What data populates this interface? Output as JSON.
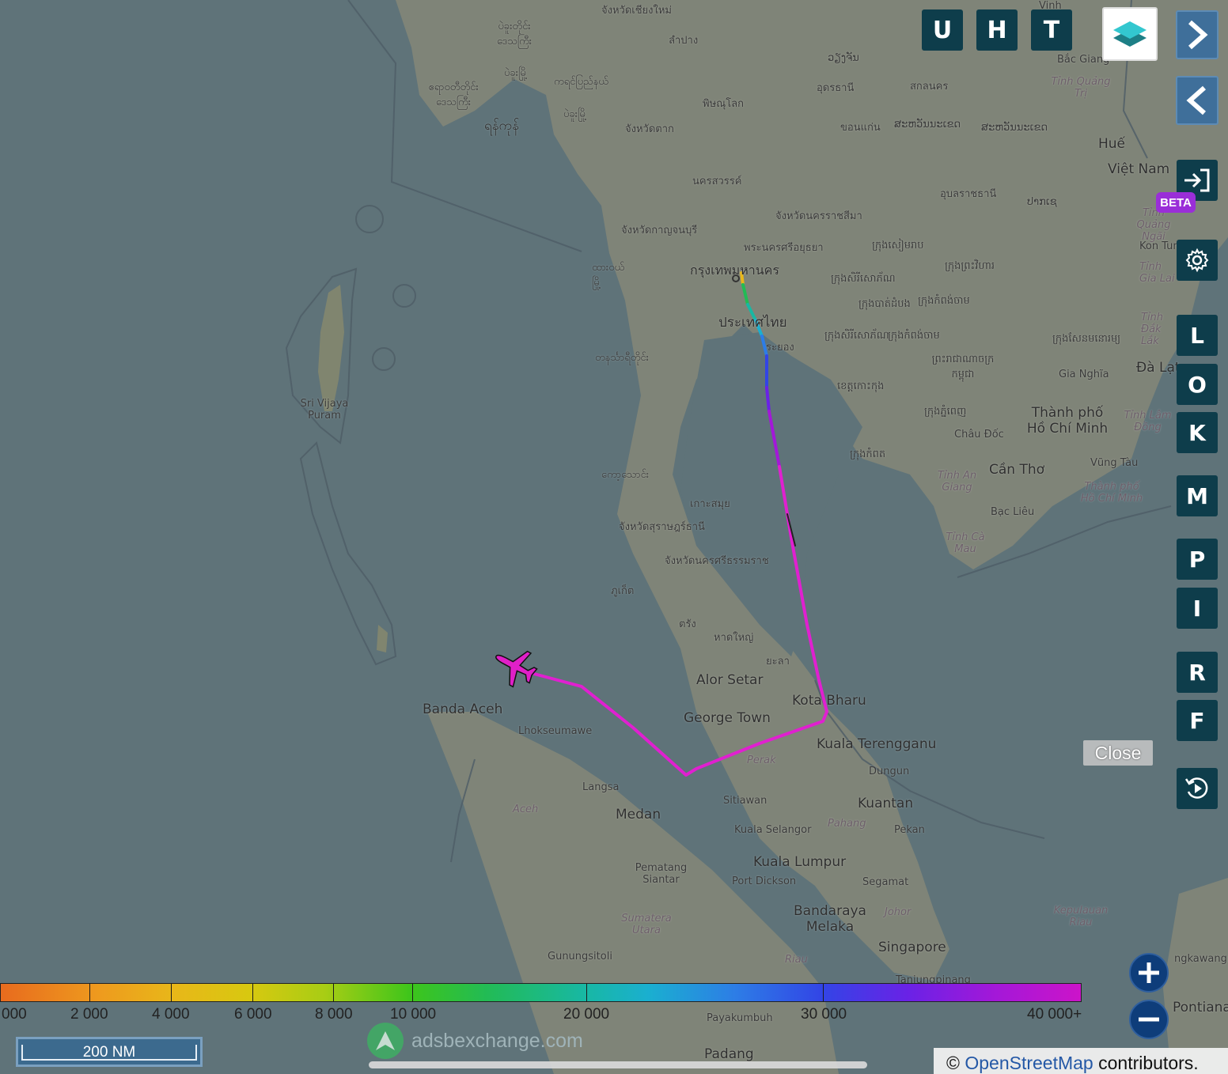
{
  "map": {
    "places": {
      "chiang_mai": "จังหวัดเชียงใหม่",
      "lampang": "ลำปาง",
      "myanmar_region": "ပဲခူးတိုင်း ဒေသကြီး",
      "bago": "ပဲခူးမြို့",
      "ayeyarwady": "ဧရာဝတီတိုင်း ဒေသကြီး",
      "karen": "ကရင်ပြည်နယ်",
      "yangon": "ရန်ကုန်",
      "phitsanulok": "พิษณุโลก",
      "tak": "จังหวัดตาก",
      "kanchanaburi": "จังหวัดกาญจนบุรี",
      "nakhon_sawan": "นครสวรรค์",
      "ayutthaya": "พระนครศรีอยุธยา",
      "bangkok": "กรุงเทพมหานคร",
      "thailand": "ประเทศไทย",
      "rayong": "ระยอง",
      "dawei": "ထားဝယ် မြို့",
      "tanintharyi": "တနင်္သာရီတိုင်း",
      "kawthoung": "ကော့သောင်း",
      "ko_samui": "เกาะสมุย",
      "surat_thani": "จังหวัดสุราษฎร์ธานี",
      "nakhon_si": "จังหวัดนครศรีธรรมราช",
      "phuket": "ภูเก็ต",
      "trang": "ตรัง",
      "hat_yai": "หาดใหญ่",
      "yala": "ยะลา",
      "nakhon_ratchasima": "จังหวัดนครราชสีมา",
      "udon": "อุดรธานี",
      "sakon": "สกลนคร",
      "khon_kaen": "ขอนแก่น",
      "ubon": "อุบลราชธานี",
      "vientiane": "ວຽງຈັນ",
      "savannakhet": "ສະຫວັນນະເຂດ",
      "savan2": "ສະຫວັນນະເຂດ",
      "pakse": "ປາກເຊ",
      "siem_reap": "ក្រុងសៀមរាប",
      "cambodia": "ព្រះរាជាណាចក្រ កម្ពុជា",
      "phnom_penh": "ក្រុងភ្នំពេញ",
      "sisophon": "ក្រុងសិរីសោភ័ណ",
      "kampong_cham": "ក្រុងកំពង់ចាម",
      "battambang": "ក្រុងបាត់ដំបង",
      "kratie": "ក្រុងព្រះវិហារ",
      "koh_kong": "ខេត្តកោះកុង",
      "kampot": "ក្រុងកំពត",
      "mondulkiri": "ក្រុងសែនមនោរម្យ",
      "vinh": "Vinh",
      "bac_giang": "Bắc Giang",
      "tinh_quang": "Tỉnh Quảng Trị",
      "hue": "Huế",
      "viet_nam": "Việt Nam",
      "tinh_quang_ngai": "Tỉnh Quảng Ngãi",
      "kon_tum": "Kon Tum",
      "tinh_gia_lai": "Tỉnh Gia Lai",
      "tinh_dak_lak": "Tỉnh Đắk Lắk",
      "da_lat": "Đà Lạt",
      "gia_nghia": "Gia Nghĩa",
      "hcmc": "Thành phố Hồ Chí Minh",
      "tinh_lam_dong": "Tỉnh Lâm Đồng",
      "chau_doc": "Châu Đốc",
      "vung_tau": "Vũng Tàu",
      "can_tho": "Cần Thơ",
      "tinh_an_giang": "Tỉnh An Giang",
      "tp_hcm": "Thành phố Hồ Chí Minh",
      "bac_lieu": "Bạc Liêu",
      "tinh_ca_mau": "Tỉnh Cà Mau",
      "sri_vijaya": "Sri Vijaya Puram",
      "banda_aceh": "Banda Aceh",
      "lhokseumawe": "Lhokseumawe",
      "aceh": "Aceh",
      "langsa": "Langsa",
      "medan": "Medan",
      "pematang": "Pematang Siantar",
      "sumatera_utara": "Sumatera Utara",
      "gunungsitoli": "Gunungsitoli",
      "alor_setar": "Alor Setar",
      "kota_bharu": "Kota Bharu",
      "george_town": "George Town",
      "kuala_terengganu": "Kuala Terengganu",
      "perak": "Perak",
      "dungun": "Dungun",
      "sitiawan": "Sitiawan",
      "kuantan": "Kuantan",
      "kuala_selangor": "Kuala Selangor",
      "pahang": "Pahang",
      "pekan": "Pekan",
      "kuala_lumpur": "Kuala Lumpur",
      "port_dickson": "Port Dickson",
      "segamat": "Segamat",
      "melaka": "Bandaraya Melaka",
      "johor": "Johor",
      "singapore": "Singapore",
      "riau": "Riau",
      "kepulauan_riau": "Kepulauan Riau",
      "tanjungpinang": "Tanjungpinang",
      "payakumbuh": "Payakumbuh",
      "padang": "Padang",
      "ngkawang": "ngkawang",
      "pontiana": "Pontiana"
    }
  },
  "toolbar_top": {
    "u": "U",
    "h": "H",
    "t": "T"
  },
  "sidebar": {
    "beta": "BETA",
    "keys": [
      "L",
      "O",
      "K",
      "M",
      "P",
      "I",
      "R",
      "F"
    ]
  },
  "close_label": "Close",
  "legend": {
    "labels": [
      "000",
      "2 000",
      "4 000",
      "6 000",
      "8 000",
      "10 000",
      "20 000",
      "30 000",
      "40 000+"
    ]
  },
  "scale": {
    "label": "200 NM"
  },
  "brand": {
    "name": "adsbexchange.com"
  },
  "attribution": {
    "symbol": "©",
    "link": "OpenStreetMap",
    "suffix": "contributors."
  },
  "colors": {
    "track": "#e020d0",
    "aircraft": "#e020c8",
    "button": "#0e3d4b"
  }
}
